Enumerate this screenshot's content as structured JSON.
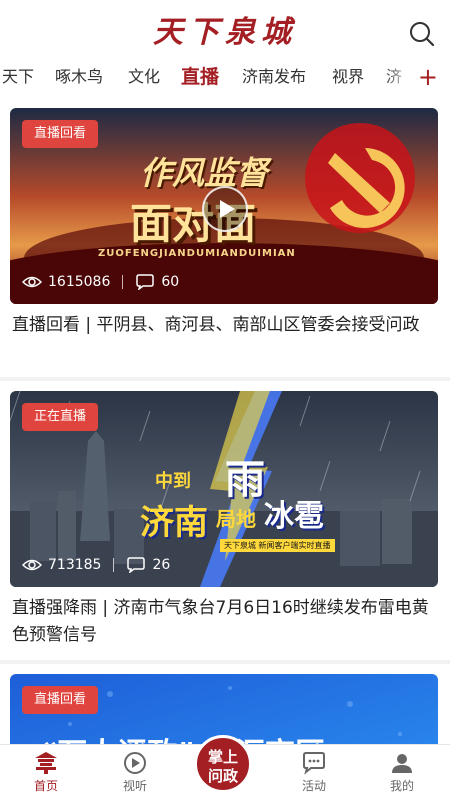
{
  "app": {
    "logo_text": "天下泉城",
    "search_icon": "search-icon"
  },
  "tabs": [
    {
      "label": "天下"
    },
    {
      "label": "啄木鸟"
    },
    {
      "label": "文化"
    },
    {
      "label": "直播",
      "active": true
    },
    {
      "label": "济南发布"
    },
    {
      "label": "视界"
    },
    {
      "label": "济"
    }
  ],
  "tab_add_label": "+",
  "feed": [
    {
      "badge": "直播回看",
      "views": "1615086",
      "comments": "60",
      "headline": "直播回看 | 平阴县、商河县、南部山区管委会接受问政",
      "thumb_title_1": "作风监督",
      "thumb_title_2": "面对面",
      "thumb_sub": "ZUOFENGJIANDUMIANDUIMIAN",
      "colors": {
        "sky_top": "#1d2a44",
        "sky_mid": "#b54a2a",
        "floor": "#7a1010"
      }
    },
    {
      "badge": "正在直播",
      "views": "713185",
      "comments": "26",
      "headline": "直播强降雨 | 济南市气象台7月6日16时继续发布雷电黄色预警信号",
      "thumb_title_1": "中到",
      "thumb_title_2": "济南",
      "thumb_title_3": "局地",
      "thumb_title_4": "雨",
      "thumb_title_5": "冰雹",
      "thumb_sub": "天下泉城 新闻客户端实时直播",
      "colors": {
        "sky_top": "#2b3545",
        "sky_bottom": "#6a7280",
        "bolt": "#4a7dff"
      }
    },
    {
      "badge": "直播回看",
      "thumb_title_1": "“万人评政” 智汇商区"
    }
  ],
  "bottom_nav": {
    "home_label": "首页",
    "video_label": "视听",
    "center_label_1": "掌上",
    "center_label_2": "问政",
    "activity_label": "活动",
    "mine_label": "我的"
  },
  "accent_color": "#a31f24",
  "badge_color": "#e0443f"
}
